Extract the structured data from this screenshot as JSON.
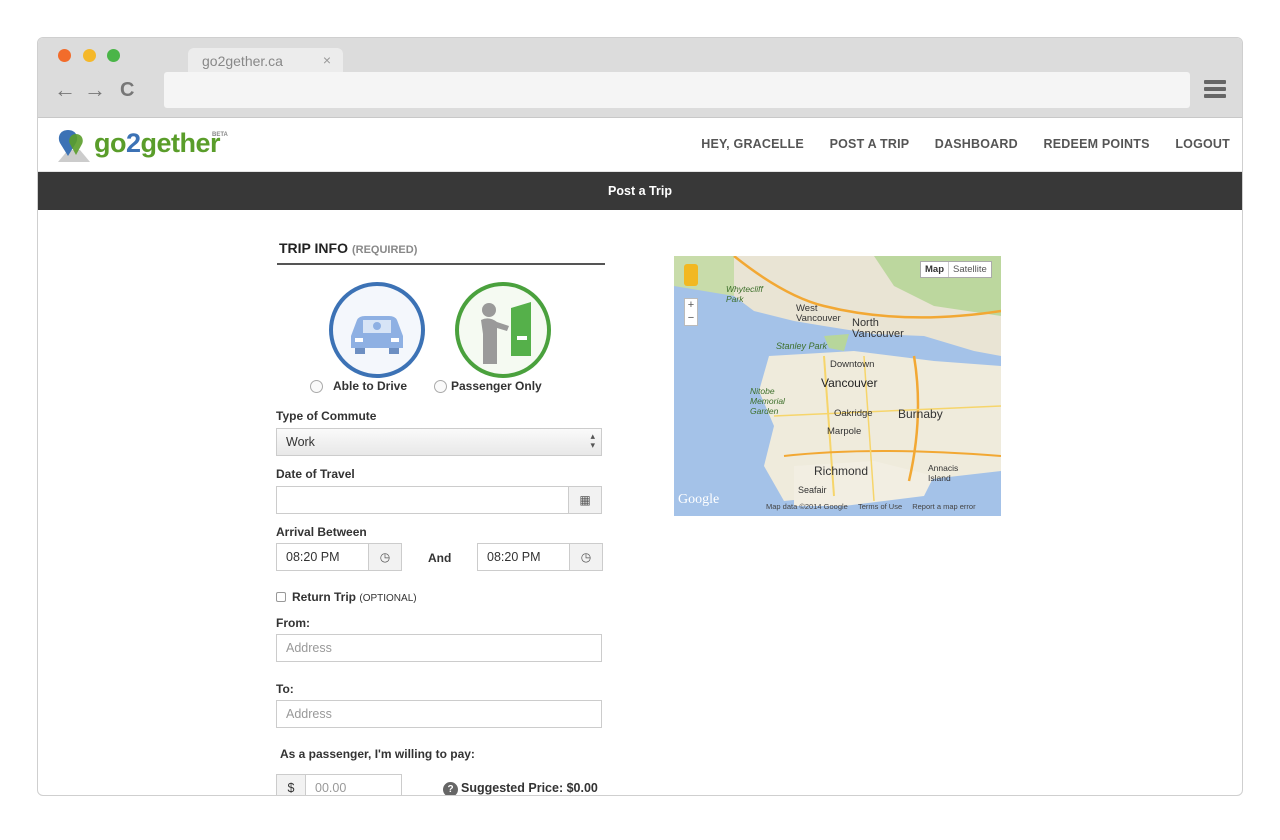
{
  "browser": {
    "tab_title": "go2gether.ca",
    "tab_close": "×",
    "back": "←",
    "forward": "→",
    "reload": "C"
  },
  "brand": {
    "name_a": "go",
    "name_b": "2",
    "name_c": "gether",
    "beta": "BETA"
  },
  "nav": {
    "greeting": "HEY, GRACELLE",
    "post_trip": "POST A TRIP",
    "dashboard": "DASHBOARD",
    "redeem": "REDEEM POINTS",
    "logout": "LOGOUT"
  },
  "subbar": {
    "title": "Post a Trip"
  },
  "form": {
    "section_title": "TRIP INFO",
    "section_note": "(REQUIRED)",
    "role_driver": "Able to Drive",
    "role_passenger": "Passenger Only",
    "commute_label": "Type of Commute",
    "commute_value": "Work",
    "date_label": "Date of Travel",
    "arrival_label": "Arrival Between",
    "time_from": "08:20 PM",
    "and_label": "And",
    "time_to": "08:20 PM",
    "return_label": "Return Trip",
    "return_note": "(OPTIONAL)",
    "from_label": "From:",
    "from_placeholder": "Address",
    "to_label": "To:",
    "to_placeholder": "Address",
    "pay_label": "As a passenger, I'm willing to pay:",
    "currency": "$",
    "price_placeholder": "00.00",
    "suggested": "Suggested Price: $0.00"
  },
  "map": {
    "type_map": "Map",
    "type_satellite": "Satellite",
    "zoom_in": "+",
    "zoom_out": "−",
    "labels": [
      "Vancouver",
      "North Vancouver",
      "West Vancouver",
      "Burnaby",
      "Richmond",
      "Downtown",
      "Stanley Park",
      "Oakridge",
      "Marpole",
      "Seafair",
      "Annacis Island",
      "Nitobe Memorial Garden",
      "Whytecliff Park"
    ],
    "attribution": "Map data ©2014 Google",
    "terms": "Terms of Use",
    "report": "Report a map error",
    "google": "Google"
  },
  "colors": {
    "brand_blue": "#3c72b5",
    "brand_green": "#5a9d2a",
    "subbar": "#383838"
  }
}
